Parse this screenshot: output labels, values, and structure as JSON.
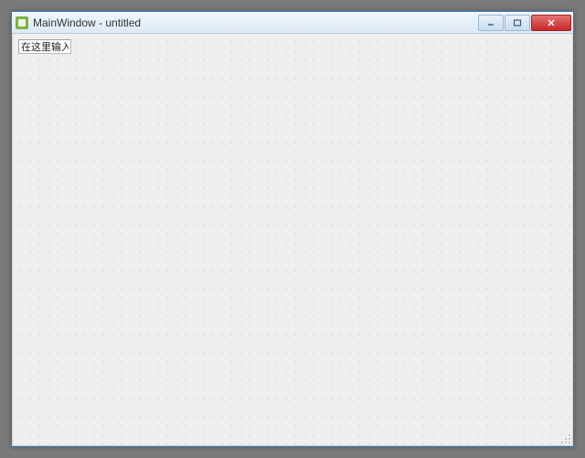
{
  "window": {
    "title": "MainWindow - untitled",
    "icon_name": "qt-designer-icon"
  },
  "controls": {
    "minimize_label": "Minimize",
    "maximize_label": "Maximize",
    "close_label": "Close"
  },
  "form": {
    "line_edit_value": "在这里输入"
  },
  "colors": {
    "accent": "#3a7ab8",
    "close_red": "#c62828",
    "grid_dot": "#bdbdbd",
    "canvas_bg": "#efefef"
  }
}
